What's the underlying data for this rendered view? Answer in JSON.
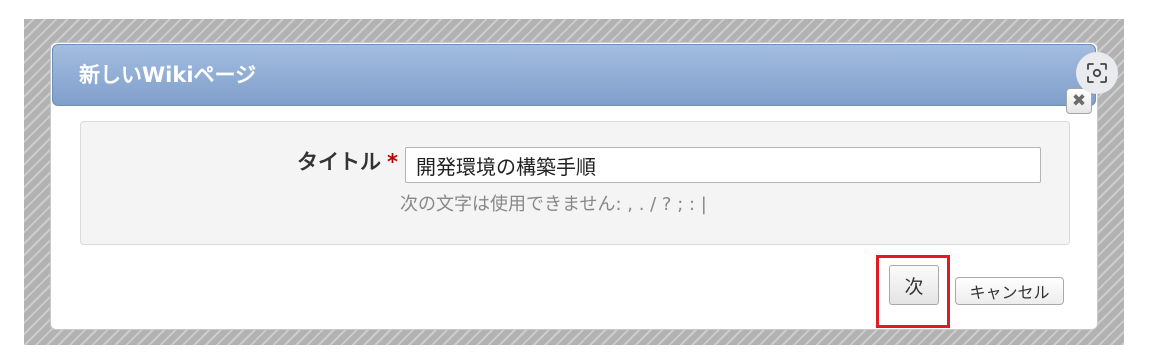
{
  "dialog": {
    "title": "新しいWikiページ",
    "close_symbol": "✖"
  },
  "form": {
    "label": "タイトル",
    "required_mark": "*",
    "title_value": "開発環境の構築手順",
    "hint": "次の文字は使用できません: , . / ? ; : |"
  },
  "buttons": {
    "next_label": "次",
    "cancel_label": "キャンセル"
  },
  "icons": {
    "close": "close-icon",
    "capture": "screen-capture-icon"
  },
  "colors": {
    "titlebar": "#8ea9d3",
    "highlight": "#e01b24",
    "required": "#bb0000"
  }
}
